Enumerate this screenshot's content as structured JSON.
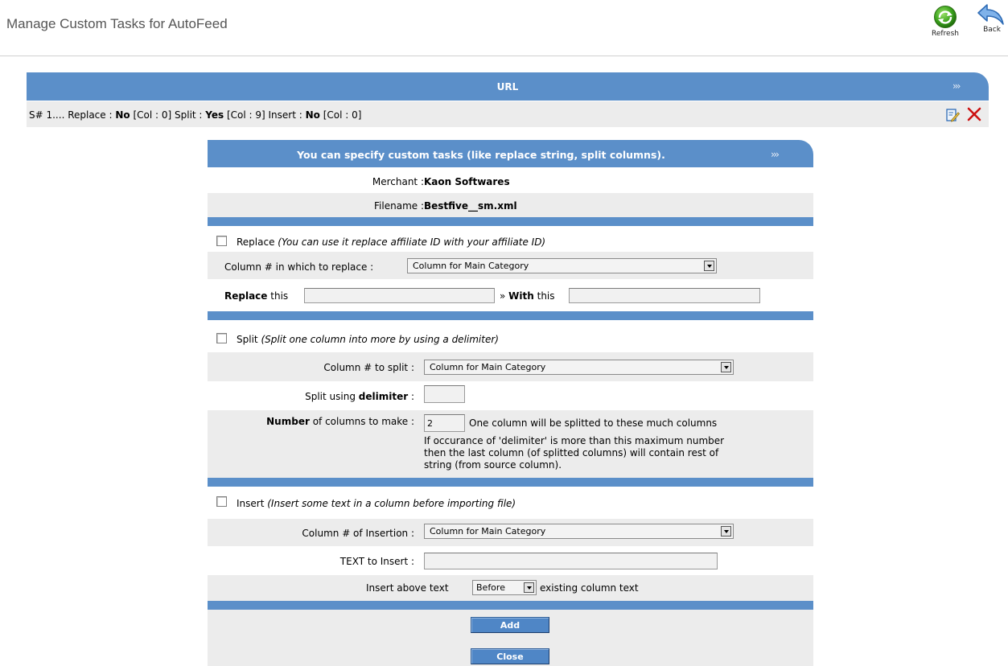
{
  "page": {
    "title": "Manage Custom Tasks for AutoFeed"
  },
  "toolbar": {
    "refresh_label": "Refresh",
    "back_label": "Back"
  },
  "url_section": {
    "title": "URL",
    "arrows": "›››"
  },
  "task": {
    "prefix": "S# 1.... Replace : ",
    "replace_flag": "No",
    "replace_col": " [Col : 0] Split : ",
    "split_flag": "Yes",
    "split_col": " [Col : 9] Insert : ",
    "insert_flag": "No",
    "insert_col": " [Col : 0]"
  },
  "dialog": {
    "title": "You can specify custom tasks (like replace string, split columns).",
    "arrows": "›››",
    "merchant_label": "Merchant :",
    "merchant_value": "Kaon Softwares",
    "filename_label": "Filename :",
    "filename_value": "Bestfive__sm.xml",
    "replace": {
      "checkbox_label": "Replace",
      "checkbox_hint": "(You can use it replace affiliate ID with your affiliate ID)",
      "column_label": "Column # in which to replace :",
      "column_selected": "Column for Main Category",
      "replace_bold": "Replace",
      "replace_this": " this",
      "with_prefix": "» ",
      "with_bold": "With",
      "with_this": " this",
      "replace_value": "",
      "with_value": ""
    },
    "split": {
      "checkbox_label": "Split",
      "checkbox_hint": "(Split one column into more by using a delimiter)",
      "column_label": "Column # to split :",
      "column_selected": "Column for Main Category",
      "delimiter_prefix": "Split using ",
      "delimiter_bold": "delimiter",
      "delimiter_suffix": " :",
      "delimiter_value": "",
      "number_bold": "Number",
      "number_suffix": " of columns to make :",
      "number_value": "2",
      "help_1": "One column will be splitted to these much columns",
      "help_2": "If occurance of 'delimiter' is more than this maximum number",
      "help_3": "then the last column (of splitted columns) will contain rest of",
      "help_4": "string (from source column)."
    },
    "insert": {
      "checkbox_label": "Insert",
      "checkbox_hint": "(Insert some text in a column before importing file)",
      "column_label": "Column # of Insertion :",
      "column_selected": "Column for Main Category",
      "text_label": "TEXT to Insert :",
      "text_value": "",
      "position_prefix": "Insert above text",
      "position_selected": "Before",
      "position_suffix": "existing column text"
    },
    "add_label": "Add",
    "close_label": "Close"
  },
  "colors": {
    "header_blue": "#5b8fc9",
    "row_gray": "#ececec",
    "button_blue": "#4f86c6",
    "delete_red": "#cc1111"
  }
}
